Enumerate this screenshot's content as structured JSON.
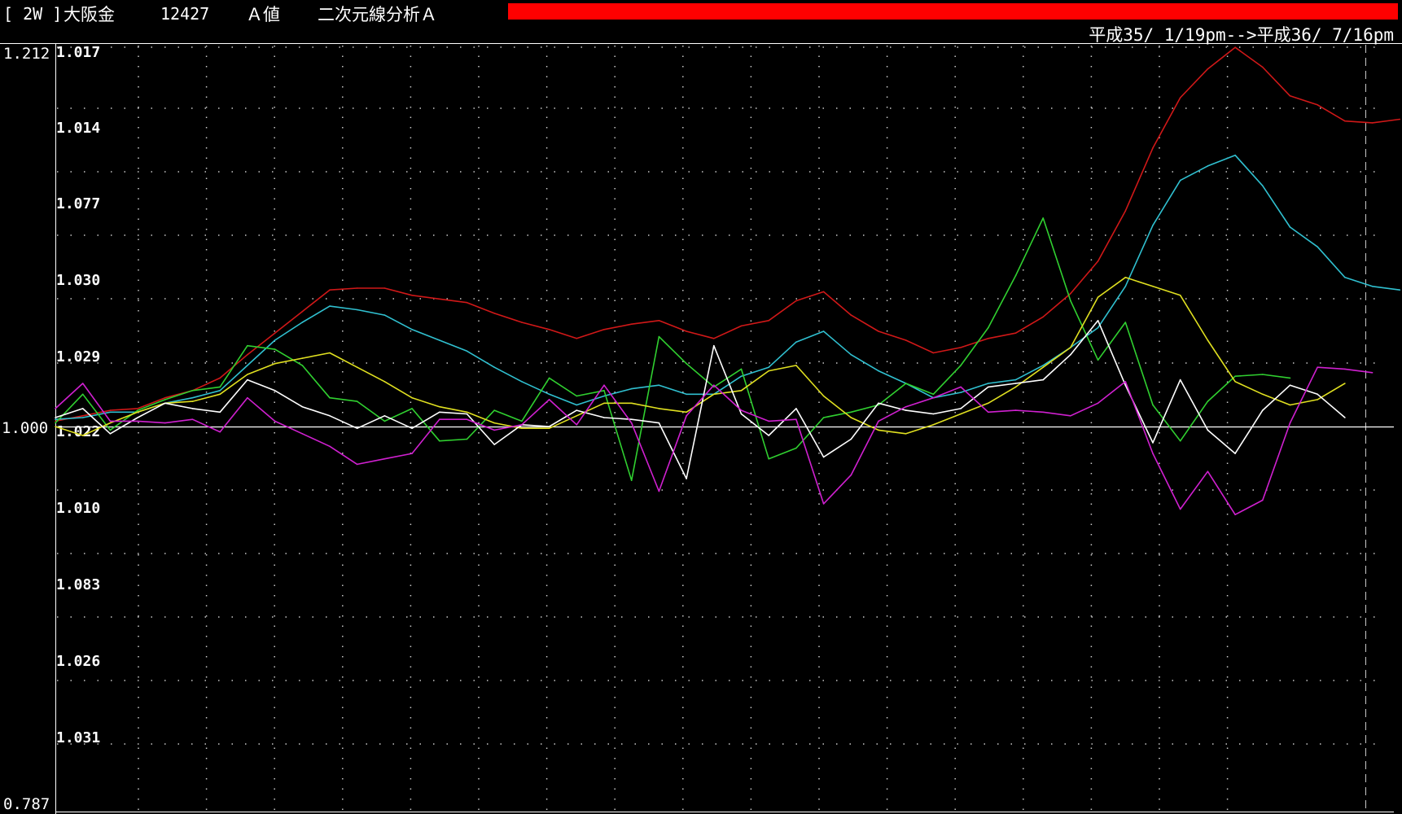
{
  "header": {
    "period": "[ 2W ]",
    "instrument": "大阪金",
    "code": "12427",
    "value_type": "Ａ値",
    "analysis": "二次元線分析Ａ",
    "date_range": "平成35/ 1/19pm-->平成36/ 7/16pm",
    "indicator_color": "#ff0000"
  },
  "axes": {
    "outer_top": "1.212",
    "outer_mid": "1.000",
    "outer_bottom": "0.787",
    "inner_labels": [
      "1.017",
      "1.014",
      "1.077",
      "1.030",
      "1.029",
      "1.022",
      "1.010",
      "1.083",
      "1.026",
      "1.031"
    ]
  },
  "colors": {
    "background": "#000000",
    "axis": "#ffffff",
    "grid_dots": "#c8c8c8",
    "baseline": "#ffffff"
  },
  "chart_data": {
    "type": "line",
    "ylim": [
      0.787,
      1.212
    ],
    "baseline": 1.0,
    "grid": true,
    "x": [
      0,
      1,
      2,
      3,
      4,
      5,
      6,
      7,
      8,
      9,
      10,
      11,
      12,
      13,
      14,
      15,
      16,
      17,
      18,
      19,
      20,
      21,
      22,
      23,
      24,
      25,
      26,
      27,
      28,
      29,
      30,
      31,
      32,
      33,
      34,
      35,
      36,
      37,
      38,
      39,
      40,
      41,
      42,
      43,
      44,
      45,
      46,
      47,
      48,
      49
    ],
    "series": [
      {
        "color": "#d01818",
        "values": [
          1.003,
          1.006,
          1.009,
          1.01,
          1.016,
          1.02,
          1.027,
          1.04,
          1.052,
          1.064,
          1.076,
          1.077,
          1.077,
          1.073,
          1.071,
          1.069,
          1.063,
          1.058,
          1.054,
          1.049,
          1.054,
          1.057,
          1.059,
          1.053,
          1.049,
          1.056,
          1.059,
          1.07,
          1.075,
          1.062,
          1.053,
          1.048,
          1.041,
          1.044,
          1.049,
          1.052,
          1.061,
          1.074,
          1.092,
          1.12,
          1.155,
          1.183,
          1.199,
          1.211,
          1.2,
          1.184,
          1.179,
          1.17,
          1.169,
          1.171
        ]
      },
      {
        "color": "#30c0d0",
        "values": [
          1.004,
          1.005,
          1.008,
          1.008,
          1.013,
          1.016,
          1.02,
          1.034,
          1.048,
          1.058,
          1.067,
          1.065,
          1.062,
          1.054,
          1.048,
          1.042,
          1.033,
          1.025,
          1.018,
          1.012,
          1.017,
          1.021,
          1.023,
          1.018,
          1.018,
          1.028,
          1.033,
          1.047,
          1.053,
          1.04,
          1.031,
          1.024,
          1.016,
          1.019,
          1.024,
          1.026,
          1.034,
          1.044,
          1.055,
          1.078,
          1.112,
          1.137,
          1.145,
          1.151,
          1.134,
          1.111,
          1.1,
          1.083,
          1.078,
          1.076
        ]
      },
      {
        "color": "#30d030",
        "values": [
          1.002,
          1.018,
          0.998,
          1.009,
          1.015,
          1.02,
          1.022,
          1.045,
          1.043,
          1.034,
          1.016,
          1.014,
          1.003,
          1.01,
          0.992,
          0.993,
          1.009,
          1.003,
          1.027,
          1.017,
          1.02,
          0.97,
          1.05,
          1.035,
          1.022,
          1.032,
          0.982,
          0.988,
          1.005,
          1.008,
          1.012,
          1.024,
          1.018,
          1.034,
          1.055,
          1.084,
          1.116,
          1.07,
          1.037,
          1.058,
          1.012,
          0.992,
          1.014,
          1.028,
          1.029,
          1.027
        ]
      },
      {
        "color": "#e0e020",
        "values": [
          1.0,
          0.995,
          1.002,
          1.008,
          1.013,
          1.014,
          1.018,
          1.029,
          1.035,
          1.038,
          1.041,
          1.033,
          1.025,
          1.016,
          1.011,
          1.008,
          1.002,
          0.999,
          0.999,
          1.006,
          1.013,
          1.013,
          1.01,
          1.008,
          1.018,
          1.02,
          1.031,
          1.034,
          1.017,
          1.005,
          0.998,
          0.996,
          1.001,
          1.007,
          1.013,
          1.022,
          1.033,
          1.044,
          1.072,
          1.083,
          1.078,
          1.073,
          1.048,
          1.025,
          1.018,
          1.012,
          1.015,
          1.024
        ]
      },
      {
        "color": "#ffffff",
        "values": [
          1.005,
          1.01,
          0.996,
          1.005,
          1.013,
          1.01,
          1.008,
          1.026,
          1.02,
          1.011,
          1.006,
          0.999,
          1.006,
          0.999,
          1.008,
          1.007,
          0.99,
          1.001,
          1.0,
          1.009,
          1.005,
          1.004,
          1.002,
          0.971,
          1.045,
          1.007,
          0.995,
          1.01,
          0.983,
          0.993,
          1.013,
          1.009,
          1.007,
          1.01,
          1.022,
          1.024,
          1.026,
          1.04,
          1.059,
          1.023,
          0.991,
          1.026,
          0.998,
          0.985,
          1.009,
          1.023,
          1.018,
          1.005
        ]
      },
      {
        "color": "#d020d0",
        "values": [
          1.01,
          1.024,
          1.003,
          1.003,
          1.002,
          1.004,
          0.997,
          1.016,
          1.003,
          0.996,
          0.989,
          0.979,
          0.982,
          0.985,
          1.004,
          1.004,
          0.998,
          1.001,
          1.015,
          1.001,
          1.023,
          1.002,
          0.964,
          1.006,
          1.023,
          1.009,
          1.003,
          1.004,
          0.957,
          0.973,
          1.003,
          1.011,
          1.016,
          1.022,
          1.008,
          1.009,
          1.008,
          1.006,
          1.013,
          1.025,
          0.985,
          0.954,
          0.975,
          0.951,
          0.959,
          1.002,
          1.033,
          1.032,
          1.03
        ]
      }
    ]
  }
}
